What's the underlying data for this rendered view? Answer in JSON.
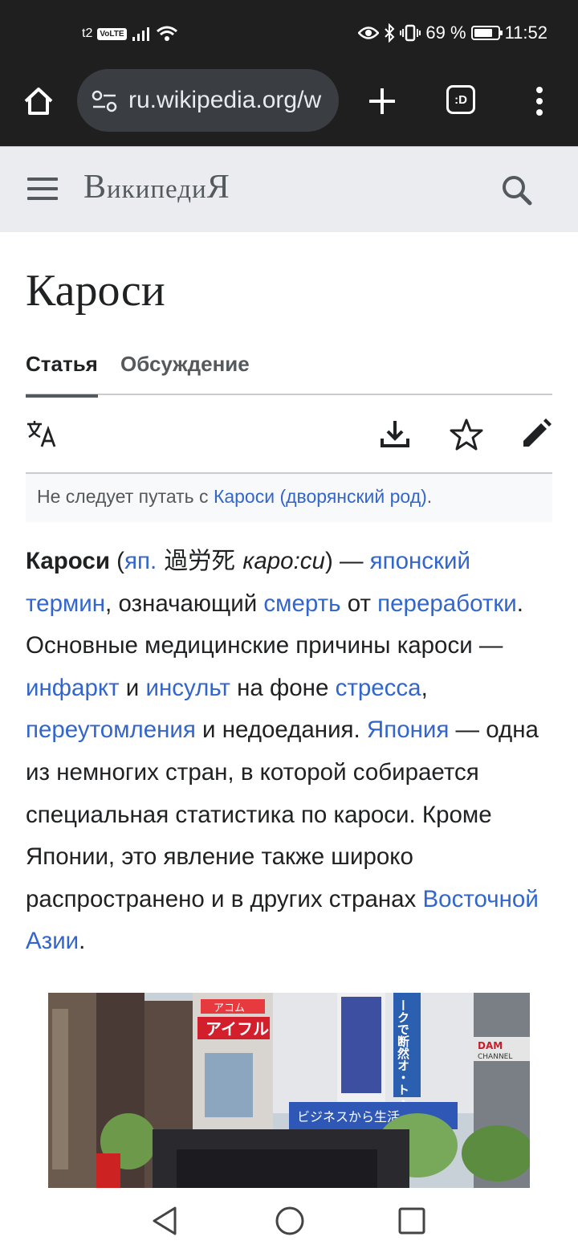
{
  "status_bar": {
    "carrier": "t2",
    "volte": "VoLTE",
    "battery_percent": "69 %",
    "time": "11:52"
  },
  "browser": {
    "url": "ru.wikipedia.org/w",
    "tabs_label": ":D"
  },
  "wiki": {
    "logo_first": "В",
    "logo_mid": "икипеди",
    "logo_last": "Я"
  },
  "article": {
    "title": "Кароси",
    "tabs": [
      "Статья",
      "Обсуждение"
    ],
    "hatnote_prefix": "Не следует путать с ",
    "hatnote_link": "Кароси (дворянский род)",
    "hatnote_suffix": ".",
    "p": {
      "bold": "Кароси",
      "t1": " (",
      "l_jp": "яп.",
      "jp_text": " 過労死 ",
      "kana": "каро:си",
      "t2": ") — ",
      "l_term": "японский термин",
      "t3": ", означающий ",
      "l_death": "смерть",
      "t4": " от ",
      "l_overwork": "переработки",
      "t5": ". Основные медицинские причины кароси — ",
      "l_infarct": "инфаркт",
      "t6": " и ",
      "l_stroke": "инсульт",
      "t7": " на фоне ",
      "l_stress": "стресса",
      "t8": ", ",
      "l_fatigue": "переутомления",
      "t9": " и недоедания. ",
      "l_japan": "Япония",
      "t10": " — одна из немногих стран, в которой собирается специальная статистика по кароси. Кроме Японии, это явление также широко распространено и в других странах ",
      "l_asia": "Восточной Азии",
      "t11": "."
    },
    "image_signs": {
      "s1": "アコム",
      "s2": "アイフル",
      "s3": "ビジネスから生活",
      "s4": "ークで断然オ・ト・ク",
      "s5": "DAM",
      "s6": "CHANNEL"
    }
  },
  "icons": [
    "home-icon",
    "tune-icon",
    "plus-icon",
    "tabs-icon",
    "more-vert-icon",
    "hamburger-icon",
    "search-icon",
    "translate-icon",
    "download-icon",
    "star-icon",
    "edit-icon",
    "nav-back-icon",
    "nav-home-icon",
    "nav-recents-icon"
  ],
  "colors": {
    "link": "#3366cc",
    "text": "#202122",
    "header_bg": "#eaecf0",
    "chrome_bg": "#1f1f1f"
  }
}
